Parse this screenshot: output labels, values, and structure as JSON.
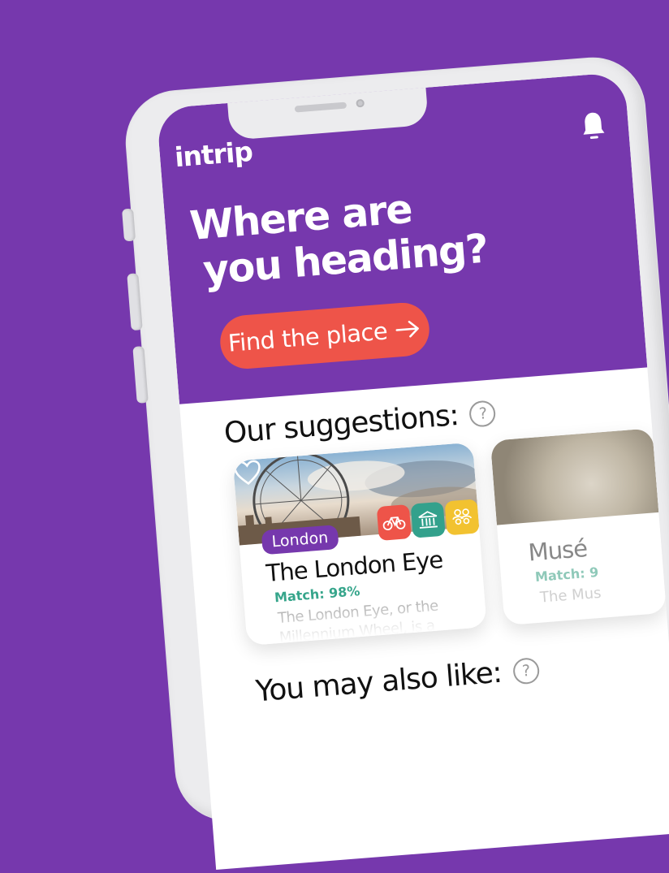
{
  "app": {
    "logo": "intrip"
  },
  "hero": {
    "title_line1": "Where are",
    "title_line2": "you heading?",
    "cta_label": "Find the place"
  },
  "suggestions": {
    "title": "Our suggestions:",
    "help": "?",
    "cards": [
      {
        "tag": "London",
        "title": "The London Eye",
        "match": "Match: 98%",
        "description": "The London Eye, or the Millennium Wheel, is a cantilevered",
        "badges": [
          "bike-icon",
          "museum-icon",
          "group-icon"
        ]
      },
      {
        "title": "Musé",
        "match": "Match: 9",
        "description": "The Mus"
      }
    ]
  },
  "also_like": {
    "title": "You may also like:",
    "help": "?"
  },
  "colors": {
    "brand_purple": "#7638ad",
    "cta_red": "#ee5449",
    "match_green": "#36a58b",
    "badge_teal": "#33a18c",
    "badge_yellow": "#f2c230"
  }
}
